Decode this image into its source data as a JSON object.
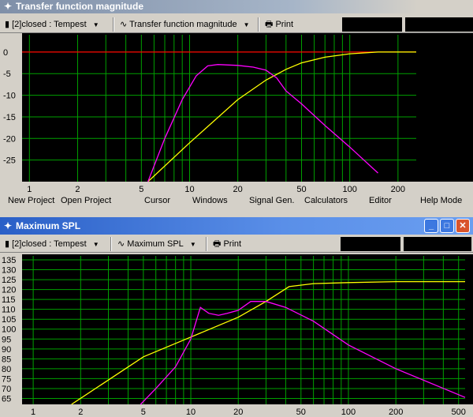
{
  "top_window": {
    "title": "Transfer function magnitude",
    "toolbar": {
      "project": "[2]closed : Tempest",
      "graph": "Transfer function magnitude",
      "print": "Print"
    },
    "chart_data": {
      "type": "line",
      "x_scale": "log",
      "xlim": [
        0.9,
        260
      ],
      "ylim": [
        -30,
        4
      ],
      "x_ticks": [
        "1",
        "2",
        "5",
        "10",
        "20",
        "50",
        "100",
        "200"
      ],
      "y_ticks": [
        "0",
        "-5",
        "-10",
        "-15",
        "-20",
        "-25"
      ],
      "grid": true,
      "series": [
        {
          "color": "#ff0000",
          "x": [
            0.9,
            260
          ],
          "y": [
            0,
            0
          ]
        },
        {
          "color": "#ffff00",
          "x": [
            5.5,
            10,
            20,
            30,
            40,
            50,
            70,
            100,
            150,
            260
          ],
          "y": [
            -30,
            -21,
            -11,
            -6.5,
            -4,
            -2.5,
            -1.2,
            -0.4,
            0,
            0
          ]
        },
        {
          "color": "#ff00ff",
          "x": [
            5.5,
            7,
            9,
            11,
            13,
            15,
            20,
            25,
            30,
            35,
            40,
            50,
            70,
            100,
            150
          ],
          "y": [
            -30,
            -20,
            -11,
            -5.5,
            -3.2,
            -2.9,
            -3.1,
            -3.5,
            -4.2,
            -6,
            -9,
            -12,
            -17,
            -22,
            -28
          ]
        }
      ]
    }
  },
  "menu": [
    "New Project",
    "Open Project",
    "Cursor",
    "Windows",
    "Signal Gen.",
    "Calculators",
    "Editor",
    "Help Mode"
  ],
  "bottom_window": {
    "title": "Maximum SPL",
    "toolbar": {
      "project": "[2]closed : Tempest",
      "graph": "Maximum SPL",
      "print": "Print"
    },
    "chart_data": {
      "type": "line",
      "x_scale": "log",
      "xlim": [
        0.85,
        550
      ],
      "ylim": [
        62,
        137
      ],
      "x_ticks": [
        "1",
        "2",
        "5",
        "10",
        "20",
        "50",
        "100",
        "200",
        "500"
      ],
      "y_ticks": [
        "135",
        "130",
        "125",
        "120",
        "115",
        "110",
        "105",
        "100",
        "95",
        "90",
        "85",
        "80",
        "75",
        "70",
        "65"
      ],
      "grid": true,
      "series": [
        {
          "color": "#ffff00",
          "x": [
            1.75,
            5,
            10,
            20,
            30,
            42,
            60,
            100,
            200,
            550
          ],
          "y": [
            62,
            86,
            96,
            106,
            114,
            121.5,
            123,
            123.5,
            124,
            124
          ]
        },
        {
          "color": "#ff00ff",
          "x": [
            4.8,
            6,
            8,
            10,
            11.5,
            13,
            15,
            17,
            20,
            24,
            30,
            40,
            60,
            100,
            200,
            550
          ],
          "y": [
            62,
            70,
            81,
            95,
            111,
            108,
            107,
            108,
            109.5,
            114,
            114,
            111,
            104,
            92,
            80,
            65.5
          ]
        }
      ]
    }
  }
}
